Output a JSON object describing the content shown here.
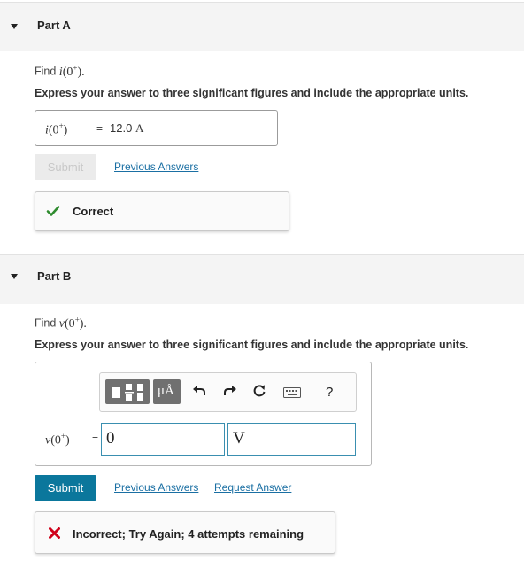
{
  "partA": {
    "title": "Part A",
    "prompt_prefix": "Find ",
    "prompt_fn": "i",
    "prompt_arg": "(0",
    "prompt_sup": "+",
    "prompt_close": ").",
    "instructions": "Express your answer to three significant figures and include the appropriate units.",
    "answer": {
      "lhs_fn": "i",
      "lhs_arg": "(0",
      "lhs_sup": "+",
      "lhs_close": ")",
      "equals": "=",
      "value": "12.0",
      "unit": "A"
    },
    "submit_label": "Submit",
    "previous_answers_label": "Previous Answers",
    "feedback": {
      "text": "Correct",
      "icon": "checkmark-icon",
      "color": "#2e8b2e"
    }
  },
  "partB": {
    "title": "Part B",
    "prompt_prefix": "Find ",
    "prompt_fn": "v",
    "prompt_arg": "(0",
    "prompt_sup": "+",
    "prompt_close": ").",
    "instructions": "Express your answer to three significant figures and include the appropriate units.",
    "toolbar": {
      "templates_icon": "templates-icon",
      "units_label": "μÅ",
      "undo_icon": "undo-icon",
      "redo_icon": "redo-icon",
      "reset_icon": "reset-icon",
      "keyboard_icon": "keyboard-icon",
      "help_label": "?"
    },
    "answer": {
      "lhs_fn": "v",
      "lhs_arg": "(0",
      "lhs_sup": "+",
      "lhs_close": ")",
      "equals": "=",
      "value": "0",
      "unit": "V"
    },
    "submit_label": "Submit",
    "previous_answers_label": "Previous Answers",
    "request_answer_label": "Request Answer",
    "feedback": {
      "text": "Incorrect; Try Again; 4 attempts remaining",
      "icon": "x-icon",
      "color": "#d0021b"
    }
  },
  "colors": {
    "accent": "#0b779c",
    "link": "#1a6fa3",
    "header_bg": "#f4f4f4"
  }
}
